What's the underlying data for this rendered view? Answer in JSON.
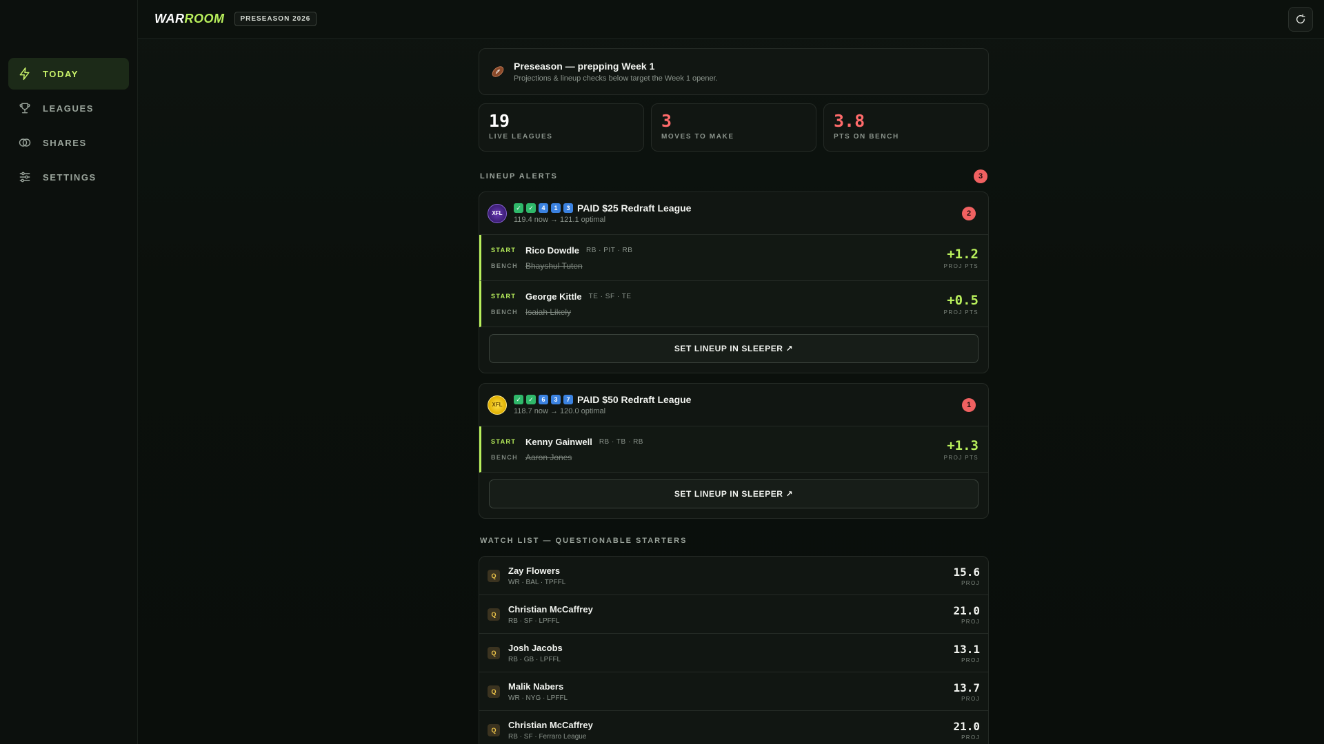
{
  "brand": {
    "logo_part1": "WAR",
    "logo_part2": "ROOM",
    "season": "PRESEASON 2026"
  },
  "sidebar": {
    "items": [
      {
        "label": "TODAY",
        "icon": "bolt-icon",
        "active": true
      },
      {
        "label": "LEAGUES",
        "icon": "trophy-icon"
      },
      {
        "label": "SHARES",
        "icon": "shares-icon"
      },
      {
        "label": "SETTINGS",
        "icon": "sliders-icon"
      }
    ]
  },
  "banner": {
    "icon": "football-icon",
    "title": "Preseason — prepping Week 1",
    "subtitle": "Projections & lineup checks below target the Week 1 opener."
  },
  "stats": [
    {
      "value": "19",
      "label": "LIVE LEAGUES",
      "color": "#ffffff"
    },
    {
      "value": "3",
      "label": "MOVES TO MAKE",
      "color": "#ff6b6b"
    },
    {
      "value": "3.8",
      "label": "PTS ON BENCH",
      "color": "#ff6b6b"
    }
  ],
  "alerts": {
    "title": "LINEUP ALERTS",
    "count": "3",
    "leagues": [
      {
        "chips": [
          "✓",
          "✓",
          "4",
          "1",
          "3"
        ],
        "name": "PAID $25 Redraft League",
        "sub": "119.4 now → 121.1 optimal",
        "badge": "2",
        "logo_text": "XFL",
        "moves": [
          {
            "start_tag": "START",
            "start": "Rico Dowdle",
            "meta": "RB · PIT · RB",
            "bench_tag": "BENCH",
            "bench": "Bhayshul Tuten",
            "delta": "+1.2",
            "delta_label": "PROJ PTS"
          },
          {
            "start_tag": "START",
            "start": "George Kittle",
            "meta": "TE · SF · TE",
            "bench_tag": "BENCH",
            "bench": "Isaiah Likely",
            "delta": "+0.5",
            "delta_label": "PROJ PTS"
          }
        ],
        "action": "SET LINEUP IN SLEEPER ↗"
      },
      {
        "chips": [
          "✓",
          "✓",
          "6",
          "3",
          "7"
        ],
        "name": "PAID $50 Redraft League",
        "sub": "118.7 now → 120.0 optimal",
        "badge": "1",
        "logo_text": "XFL",
        "moves": [
          {
            "start_tag": "START",
            "start": "Kenny Gainwell",
            "meta": "RB · TB · RB",
            "bench_tag": "BENCH",
            "bench": "Aaron Jones",
            "delta": "+1.3",
            "delta_label": "PROJ PTS"
          }
        ],
        "action": "SET LINEUP IN SLEEPER ↗"
      }
    ]
  },
  "watch": {
    "title": "WATCH LIST — QUESTIONABLE STARTERS",
    "rows": [
      {
        "status": "Q",
        "name": "Zay Flowers",
        "meta": "WR · BAL · TPFFL",
        "proj": "15.6",
        "proj_label": "PROJ"
      },
      {
        "status": "Q",
        "name": "Christian McCaffrey",
        "meta": "RB · SF · LPFFL",
        "proj": "21.0",
        "proj_label": "PROJ"
      },
      {
        "status": "Q",
        "name": "Josh Jacobs",
        "meta": "RB · GB · LPFFL",
        "proj": "13.1",
        "proj_label": "PROJ"
      },
      {
        "status": "Q",
        "name": "Malik Nabers",
        "meta": "WR · NYG · LPFFL",
        "proj": "13.7",
        "proj_label": "PROJ"
      },
      {
        "status": "Q",
        "name": "Christian McCaffrey",
        "meta": "RB · SF · Ferraro League",
        "proj": "21.0",
        "proj_label": "PROJ"
      }
    ]
  }
}
